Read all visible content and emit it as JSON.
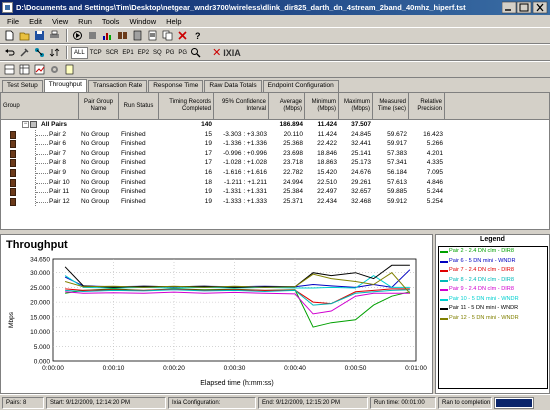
{
  "window": {
    "title": "D:\\Documents and Settings\\Tim\\Desktop\\netgear_wndr3700\\wireless\\dlink_dir825_darth_dn_4stream_2band_40mhz_hiperf.tst"
  },
  "menu": [
    "File",
    "Edit",
    "View",
    "Run",
    "Tools",
    "Window",
    "Help"
  ],
  "toolbar2": {
    "filters": [
      "ALL",
      "TCP",
      "SCR",
      "EP1",
      "EP2",
      "SQ",
      "PG",
      "PG"
    ],
    "brand": "IXIA"
  },
  "tabs": [
    "Test Setup",
    "Throughput",
    "Transaction Rate",
    "Response Time",
    "Raw Data Totals",
    "Endpoint Configuration"
  ],
  "table": {
    "headers": {
      "group": "Group",
      "pair_group": "Pair Group Name",
      "run_status": "Run Status",
      "timing": "Timing Records Completed",
      "ci": "95% Confidence Interval",
      "avg": "Average (Mbps)",
      "min": "Minimum (Mbps)",
      "max": "Maximum (Mbps)",
      "time": "Measured Time (sec)",
      "rel": "Relative Precision"
    },
    "all_pairs": {
      "label": "All Pairs",
      "timing": "140",
      "avg": "186.894",
      "min": "11.424",
      "max": "37.507"
    },
    "rows": [
      {
        "pair": "Pair 2",
        "group": "No Group",
        "status": "Finished",
        "timing": "15",
        "ci": "-3.303 : +3.303",
        "avg": "20.110",
        "min": "11.424",
        "max": "24.845",
        "time": "59.672",
        "rel": "16.423"
      },
      {
        "pair": "Pair 6",
        "group": "No Group",
        "status": "Finished",
        "timing": "19",
        "ci": "-1.336 : +1.336",
        "avg": "25.368",
        "min": "22.422",
        "max": "32.441",
        "time": "59.917",
        "rel": "5.266"
      },
      {
        "pair": "Pair 7",
        "group": "No Group",
        "status": "Finished",
        "timing": "17",
        "ci": "-0.996 : +0.996",
        "avg": "23.698",
        "min": "18.846",
        "max": "25.141",
        "time": "57.383",
        "rel": "4.201"
      },
      {
        "pair": "Pair 8",
        "group": "No Group",
        "status": "Finished",
        "timing": "17",
        "ci": "-1.028 : +1.028",
        "avg": "23.718",
        "min": "18.863",
        "max": "25.173",
        "time": "57.341",
        "rel": "4.335"
      },
      {
        "pair": "Pair 9",
        "group": "No Group",
        "status": "Finished",
        "timing": "16",
        "ci": "-1.616 : +1.616",
        "avg": "22.782",
        "min": "15.420",
        "max": "24.676",
        "time": "56.184",
        "rel": "7.095"
      },
      {
        "pair": "Pair 10",
        "group": "No Group",
        "status": "Finished",
        "timing": "18",
        "ci": "-1.211 : +1.211",
        "avg": "24.994",
        "min": "22.510",
        "max": "29.261",
        "time": "57.613",
        "rel": "4.846"
      },
      {
        "pair": "Pair 11",
        "group": "No Group",
        "status": "Finished",
        "timing": "19",
        "ci": "-1.331 : +1.331",
        "avg": "25.384",
        "min": "22.497",
        "max": "32.657",
        "time": "59.885",
        "rel": "5.244"
      },
      {
        "pair": "Pair 12",
        "group": "No Group",
        "status": "Finished",
        "timing": "19",
        "ci": "-1.333 : +1.333",
        "avg": "25.371",
        "min": "22.434",
        "max": "32.468",
        "time": "59.912",
        "rel": "5.254"
      }
    ]
  },
  "chart_data": {
    "type": "line",
    "title": "Throughput",
    "xlabel": "Elapsed time (h:mm:ss)",
    "ylabel": "Mbps",
    "ylim": [
      0,
      34.65
    ],
    "yticks": [
      "34.650",
      "30.000",
      "25.000",
      "20.000",
      "15.000",
      "10.000",
      "5.000",
      "0.000"
    ],
    "xticks": [
      "0:00:00",
      "0:00:10",
      "0:00:20",
      "0:00:30",
      "0:00:40",
      "0:00:50",
      "0:01:00"
    ],
    "x": [
      2,
      5,
      10,
      15,
      20,
      25,
      30,
      35,
      40,
      43,
      46,
      50,
      53,
      56,
      59
    ],
    "series": [
      {
        "name": "Pair 2 - 2.4 DN clm - DIR8",
        "color": "#00a000",
        "values": [
          23.0,
          24.0,
          24.5,
          24.0,
          24.5,
          24.2,
          24.4,
          24.0,
          24.2,
          11.5,
          13.0,
          14.0,
          19.0,
          22.0,
          23.5
        ]
      },
      {
        "name": "Pair 6 - 5 DN mini - WNDR",
        "color": "#0000c0",
        "values": [
          28.5,
          25.5,
          25.2,
          25.4,
          25.2,
          25.4,
          25.2,
          25.4,
          25.2,
          26.0,
          25.5,
          25.0,
          26.0,
          25.0,
          31.0
        ]
      },
      {
        "name": "Pair 7 - 2.4 DN clm - DIR8",
        "color": "#e00000",
        "values": [
          24.5,
          24.0,
          24.2,
          24.0,
          24.4,
          24.0,
          24.2,
          24.0,
          24.1,
          20.0,
          19.5,
          23.5,
          24.0,
          24.5,
          24.5
        ]
      },
      {
        "name": "Pair 8 - 2.4 DN clm - DIR8",
        "color": "#00b8b8",
        "values": [
          24.0,
          23.6,
          24.0,
          23.8,
          24.2,
          23.8,
          24.0,
          23.6,
          24.0,
          19.0,
          19.5,
          23.0,
          23.5,
          24.0,
          24.2
        ]
      },
      {
        "name": "Pair 9 - 2.4 DN clm - DIR8",
        "color": "#d000d0",
        "values": [
          23.5,
          23.0,
          23.2,
          23.0,
          23.4,
          23.0,
          23.3,
          23.0,
          22.8,
          16.0,
          17.0,
          22.0,
          23.0,
          23.0,
          23.0
        ]
      },
      {
        "name": "Pair 10 - 5 DN mini - WNDR",
        "color": "#00d0d0",
        "values": [
          29.0,
          25.0,
          24.8,
          25.0,
          24.8,
          25.0,
          24.8,
          25.0,
          24.8,
          24.8,
          25.0,
          24.8,
          29.0,
          25.0,
          25.0
        ]
      },
      {
        "name": "Pair 11 - 5 DN mini - WNDR",
        "color": "#000000",
        "values": [
          32.0,
          25.5,
          25.0,
          25.4,
          25.2,
          25.4,
          25.0,
          25.2,
          25.2,
          30.0,
          29.0,
          30.0,
          28.0,
          32.5,
          32.5
        ]
      },
      {
        "name": "Pair 12 - 5 DN mini - WNDR",
        "color": "#808000",
        "values": [
          27.0,
          25.2,
          25.4,
          25.0,
          25.4,
          25.0,
          25.4,
          25.0,
          25.2,
          29.5,
          28.0,
          27.0,
          26.0,
          30.0,
          23.0
        ]
      }
    ]
  },
  "status": {
    "pairs": "Pairs: 8",
    "start": "Start: 9/12/2009, 12:14:20 PM",
    "ixia_config": "Ixia Configuration:",
    "end": "End: 9/12/2009, 12:15:20 PM",
    "run_time": "Run time: 00:01:00",
    "completion": "Ran to completion",
    "progress": 1.0
  }
}
